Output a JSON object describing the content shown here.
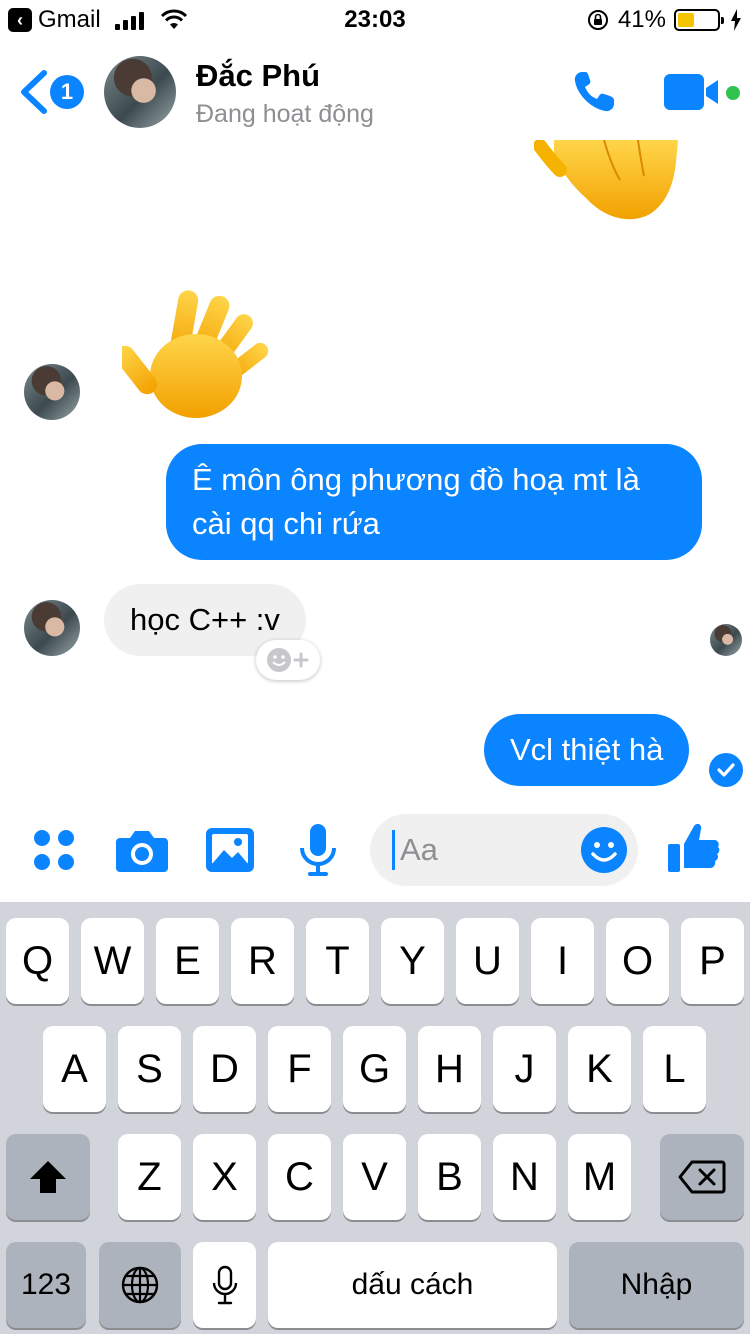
{
  "status_bar": {
    "back_app": "Gmail",
    "time": "23:03",
    "battery_percent": "41%",
    "battery_level": 0.41,
    "battery_color": "#f5c400"
  },
  "header": {
    "back_badge": "1",
    "contact_name": "Đắc Phú",
    "contact_status": "Đang hoạt động",
    "accent_color": "#0a84ff",
    "online_color": "#31c24d"
  },
  "messages": [
    {
      "type": "sticker",
      "sender": "me",
      "icon": "waving-hand-sticker"
    },
    {
      "type": "sticker",
      "sender": "contact",
      "icon": "waving-hand-sticker"
    },
    {
      "type": "text",
      "sender": "me",
      "lines": [
        "Ê môn ông phương đồ hoạ mt là",
        "cài qq chi rứa"
      ]
    },
    {
      "type": "text",
      "sender": "contact",
      "text": "học C++ :v"
    },
    {
      "type": "text",
      "sender": "me",
      "text": "Vcl thiệt hà",
      "status": "delivered"
    }
  ],
  "composer": {
    "placeholder": "Aa",
    "icons": [
      "apps-icon",
      "camera-icon",
      "image-icon",
      "microphone-icon",
      "emoji-icon",
      "thumbs-up-icon"
    ]
  },
  "keyboard": {
    "row1": [
      "Q",
      "W",
      "E",
      "R",
      "T",
      "Y",
      "U",
      "I",
      "O",
      "P"
    ],
    "row2": [
      "A",
      "S",
      "D",
      "F",
      "G",
      "H",
      "J",
      "K",
      "L"
    ],
    "row3": [
      "Z",
      "X",
      "C",
      "V",
      "B",
      "N",
      "M"
    ],
    "numbers_key": "123",
    "space_key": "dấu cách",
    "return_key": "Nhập"
  }
}
